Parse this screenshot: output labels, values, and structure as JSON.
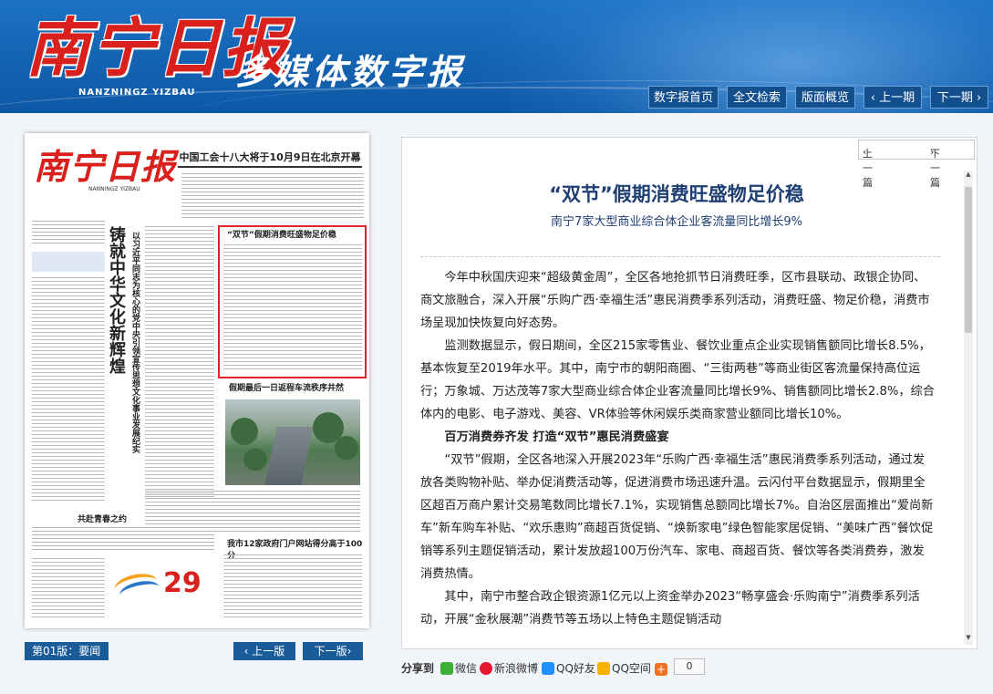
{
  "header": {
    "logo_text": "南宁日报",
    "logo_en": "NANZNINGZ YIZBAU",
    "slogan": "多媒体数字报",
    "nav": [
      {
        "label": "数字报首页"
      },
      {
        "label": "全文检索"
      },
      {
        "label": "版面概览"
      },
      {
        "label": "上一期"
      },
      {
        "label": "下一期"
      }
    ]
  },
  "paper": {
    "mast": "南宁日报",
    "mast_en": "NANNINGZ YIZBAU",
    "headline": "中国工会十八大将于10月9日在北京开幕",
    "vertical_title": "铸就中华文化新辉煌",
    "vertical_sub": "以习近平同志为核心的党中央引领宣传思想文化事业发展纪实",
    "highlight_title": "“双节”假期消费旺盛物足价稳",
    "photo_title": "假期最后一日返程车流秩序井然",
    "section2": "共赴青春之约",
    "section3": "我市12家政府门户网站得分高于100分",
    "banner_number": "29"
  },
  "edition": {
    "label": "第01版：要闻",
    "prev": "上一版",
    "next": "下一版"
  },
  "article": {
    "prev": "上一篇",
    "next": "下一篇",
    "title": "“双节”假期消费旺盛物足价稳",
    "subtitle": "南宁7家大型商业综合体企业客流量同比增长9%",
    "paragraphs": [
      "今年中秋国庆迎来“超级黄金周”，全区各地抢抓节日消费旺季，区市县联动、政银企协同、商文旅融合，深入开展“乐购广西·幸福生活”惠民消费季系列活动，消费旺盛、物足价稳，消费市场呈现加快恢复向好态势。",
      "监测数据显示，假日期间，全区215家零售业、餐饮业重点企业实现销售额同比增长8.5%，基本恢复至2019年水平。其中，南宁市的朝阳商圈、“三街两巷”等商业街区客流量保持高位运行；万象城、万达茂等7家大型商业综合体企业客流量同比增长9%、销售额同比增长2.8%，综合体内的电影、电子游戏、美容、VR体验等休闲娱乐类商家营业额同比增长10%。",
      "百万消费券齐发 打造“双节”惠民消费盛宴",
      "“双节”假期，全区各地深入开展2023年“乐购广西·幸福生活”惠民消费季系列活动，通过发放各类购物补贴、举办促消费活动等，促进消费市场迅速升温。云闪付平台数据显示，假期里全区超百万商户累计交易笔数同比增长7.1%，实现销售总额同比增长7%。自治区层面推出“爱尚新车”新车购车补贴、“欢乐惠购”商超百货促销、“焕新家电”绿色智能家居促销、“美味广西”餐饮促销等系列主题促销活动，累计发放超100万份汽车、家电、商超百货、餐饮等各类消费券，激发消费热情。",
      "其中，南宁市整合政企银资源1亿元以上资金举办2023“畅享盛会·乐购南宁”消费季系列活动，开展“金秋展潮”消费节等五场以上特色主题促销活动"
    ]
  },
  "share": {
    "label": "分享到",
    "items": [
      {
        "label": "微信",
        "color": "#3cb034"
      },
      {
        "label": "新浪微博",
        "color": "#e6162d"
      },
      {
        "label": "QQ好友",
        "color": "#1e90ff"
      },
      {
        "label": "QQ空间",
        "color": "#f6b400"
      }
    ],
    "count": "0"
  }
}
